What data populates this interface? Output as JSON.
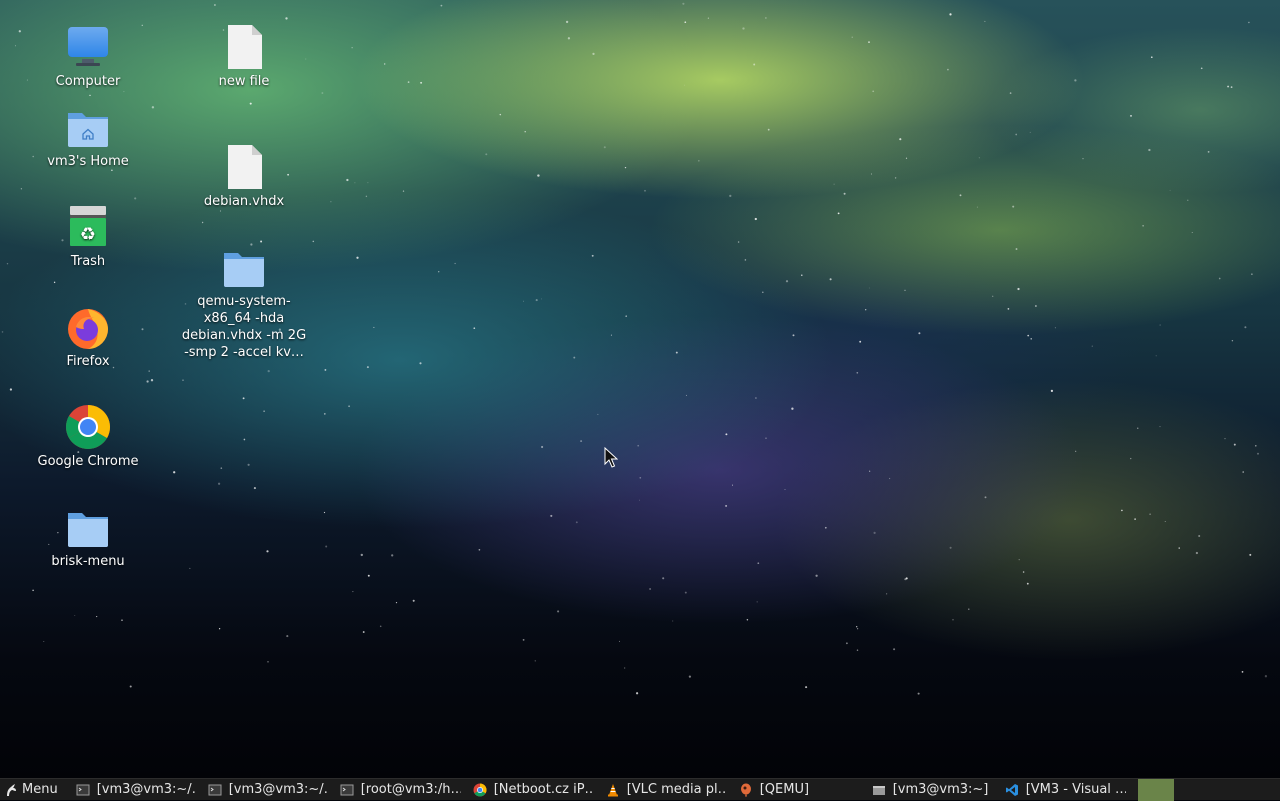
{
  "desktop": {
    "icons": [
      {
        "label": "Computer",
        "icon": "computer-icon"
      },
      {
        "label": "vm3's Home",
        "icon": "home-folder-icon"
      },
      {
        "label": "Trash",
        "icon": "trash-icon"
      },
      {
        "label": "Firefox",
        "icon": "firefox-icon"
      },
      {
        "label": "Google Chrome",
        "icon": "chrome-icon"
      },
      {
        "label": "brisk-menu",
        "icon": "folder-icon"
      },
      {
        "label": "new file",
        "icon": "file-icon"
      },
      {
        "label": "debian.vhdx",
        "icon": "file-icon"
      },
      {
        "label": "qemu-system-x86_64 -hda debian.vhdx -m 2G -smp 2 -accel kv…",
        "icon": "folder-icon"
      }
    ]
  },
  "taskbar": {
    "menu_label": "Menu",
    "tasks": [
      {
        "label": "[vm3@vm3:~/…",
        "icon": "terminal-icon"
      },
      {
        "label": "[vm3@vm3:~/…",
        "icon": "terminal-icon"
      },
      {
        "label": "[root@vm3:/h…",
        "icon": "terminal-icon"
      },
      {
        "label": "[Netboot.cz iP…",
        "icon": "chrome-icon"
      },
      {
        "label": "[VLC media pl…",
        "icon": "vlc-icon"
      },
      {
        "label": "[QEMU]",
        "icon": "qemu-icon"
      },
      {
        "label": "[vm3@vm3:~]",
        "icon": "folder-window-icon"
      },
      {
        "label": "[VM3 - Visual …",
        "icon": "vscode-icon"
      }
    ],
    "workspace_color": "#6a8449"
  }
}
